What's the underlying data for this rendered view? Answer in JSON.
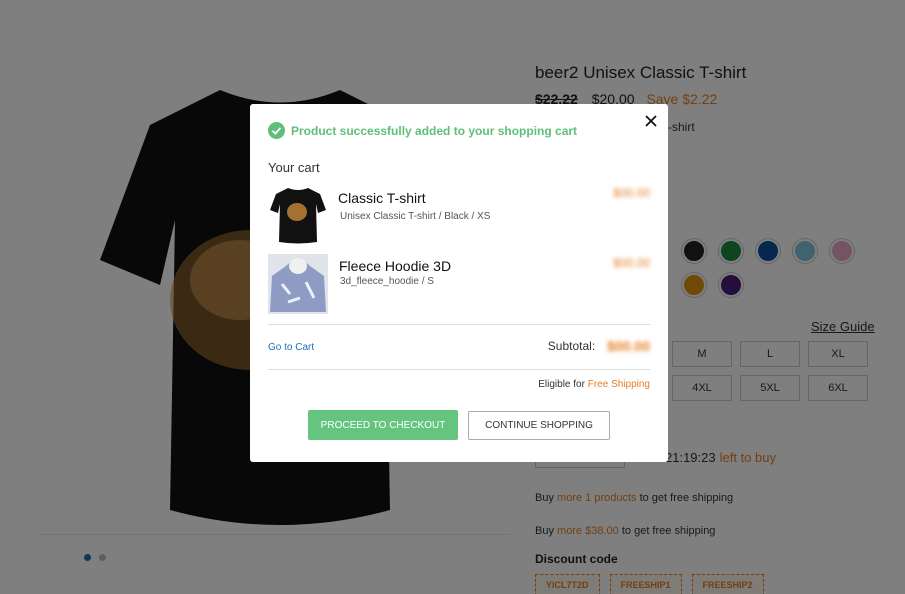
{
  "product": {
    "title": "beer2 Unisex Classic T-shirt",
    "old_price": "$22.22",
    "price": "$20.00",
    "save": "Save $2.22",
    "subtitle_fragment": "-shirt",
    "size_guide": "Size Guide",
    "sizes": [
      "M",
      "L",
      "XL",
      "4XL",
      "5XL",
      "6XL"
    ],
    "swatch_colors": [
      "#222222",
      "#1a8a3c",
      "#0b4fa0",
      "#7fc8de",
      "#e8a9c8",
      "#e0920e",
      "#4b1a78"
    ],
    "timer_value": "21:19:23",
    "timer_suffix": "left to buy",
    "promo1": {
      "prefix": "Buy",
      "highlight": "more 1 products",
      "suffix": "to get free shipping"
    },
    "promo2": {
      "prefix": "Buy",
      "highlight": "more $38.00",
      "suffix": "to get free shipping"
    },
    "discount_title": "Discount code",
    "discount_codes": [
      "YICL7T2D",
      "FREESHIP1",
      "FREESHIP2"
    ]
  },
  "modal": {
    "success_message": "Product successfully added to your shopping cart",
    "cart_title": "Your cart",
    "items": [
      {
        "name": "Classic T-shirt",
        "variant": "Unisex Classic T-shirt / Black / XS",
        "price": "$00.00"
      },
      {
        "name": "Fleece Hoodie 3D",
        "variant": "3d_fleece_hoodie / S",
        "price": "$00.00"
      }
    ],
    "go_to_cart": "Go to Cart",
    "subtotal_label": "Subtotal:",
    "subtotal_value": "$00.00",
    "eligible_prefix": "Eligible for",
    "eligible_highlight": "Free Shipping",
    "checkout_button": "PROCEED TO CHECKOUT",
    "continue_button": "CONTINUE SHOPPING"
  },
  "colors": {
    "accent_orange": "#e67e22",
    "success_green": "#5fbf79",
    "link_blue": "#1d6fb8",
    "overlay": "rgba(0,0,0,0.5)"
  }
}
